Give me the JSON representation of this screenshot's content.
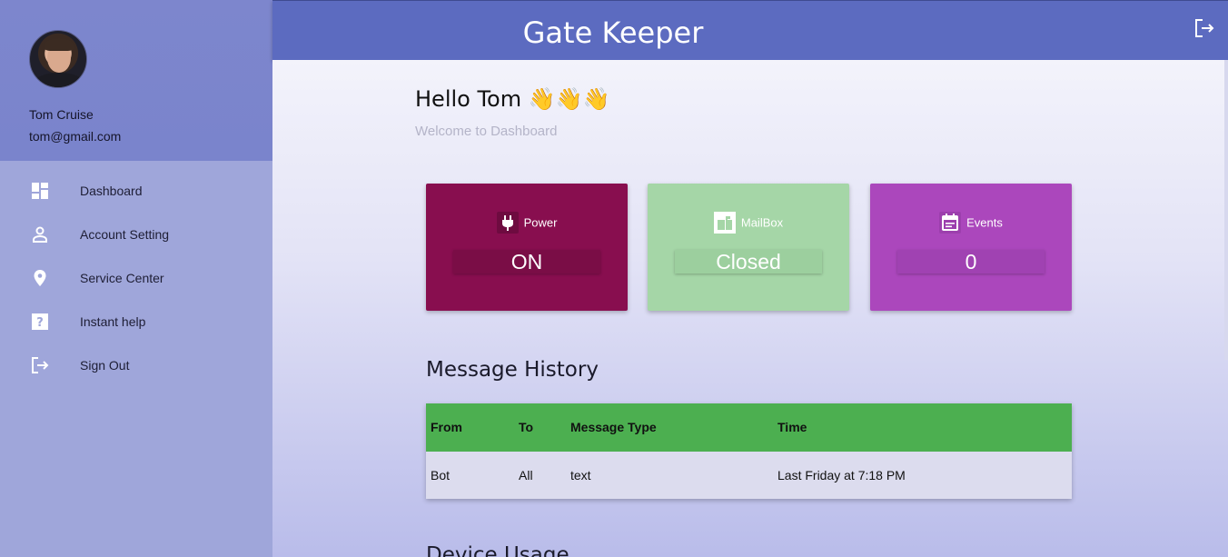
{
  "app": {
    "title": "Gate Keeper"
  },
  "user": {
    "name": "Tom Cruise",
    "email": "tom@gmail.com"
  },
  "sidebar": {
    "items": [
      {
        "label": "Dashboard",
        "icon": "dashboard-icon"
      },
      {
        "label": "Account Setting",
        "icon": "person-icon"
      },
      {
        "label": "Service Center",
        "icon": "location-pin-icon"
      },
      {
        "label": "Instant help",
        "icon": "help-icon"
      },
      {
        "label": "Sign Out",
        "icon": "sign-out-icon"
      }
    ]
  },
  "dashboard": {
    "greeting": "Hello Tom 👋👋👋",
    "subtitle": "Welcome to Dashboard"
  },
  "cards": [
    {
      "label": "Power",
      "value": "ON",
      "icon": "plug-icon",
      "color": "#880e4f"
    },
    {
      "label": "MailBox",
      "value": "Closed",
      "icon": "mailbox-icon",
      "color": "#a5d6a7"
    },
    {
      "label": "Events",
      "value": "0",
      "icon": "calendar-icon",
      "color": "#ab47bc"
    }
  ],
  "message_history": {
    "title": "Message History",
    "columns": [
      "From",
      "To",
      "Message Type",
      "Time"
    ],
    "rows": [
      [
        "Bot",
        "All",
        "text",
        "Last Friday at 7:18 PM"
      ]
    ]
  },
  "device_usage": {
    "title": "Device Usage"
  },
  "colors": {
    "topbar": "#5c6bc0",
    "sidebar": "#9fa6da",
    "table_header": "#4caf50"
  }
}
